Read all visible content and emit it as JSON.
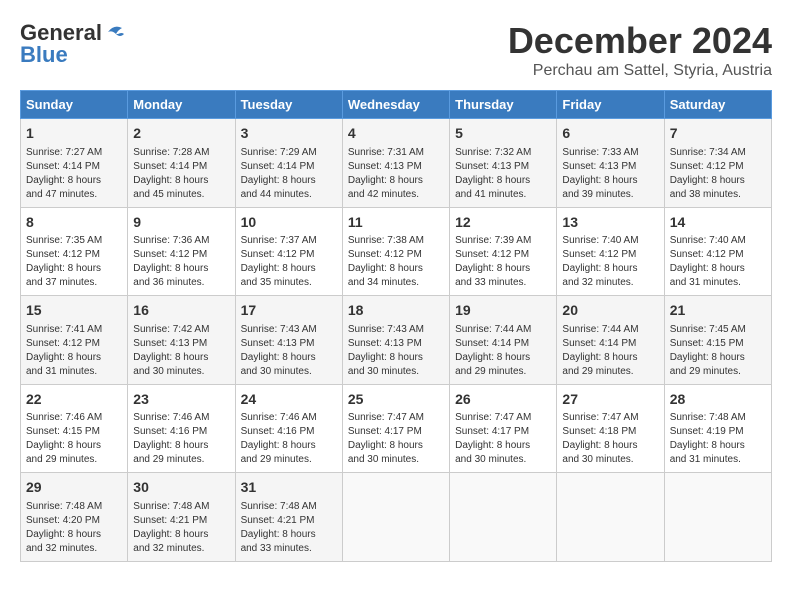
{
  "header": {
    "logo_line1": "General",
    "logo_line2": "Blue",
    "month": "December 2024",
    "location": "Perchau am Sattel, Styria, Austria"
  },
  "weekdays": [
    "Sunday",
    "Monday",
    "Tuesday",
    "Wednesday",
    "Thursday",
    "Friday",
    "Saturday"
  ],
  "weeks": [
    [
      {
        "day": "1",
        "info": "Sunrise: 7:27 AM\nSunset: 4:14 PM\nDaylight: 8 hours\nand 47 minutes."
      },
      {
        "day": "2",
        "info": "Sunrise: 7:28 AM\nSunset: 4:14 PM\nDaylight: 8 hours\nand 45 minutes."
      },
      {
        "day": "3",
        "info": "Sunrise: 7:29 AM\nSunset: 4:14 PM\nDaylight: 8 hours\nand 44 minutes."
      },
      {
        "day": "4",
        "info": "Sunrise: 7:31 AM\nSunset: 4:13 PM\nDaylight: 8 hours\nand 42 minutes."
      },
      {
        "day": "5",
        "info": "Sunrise: 7:32 AM\nSunset: 4:13 PM\nDaylight: 8 hours\nand 41 minutes."
      },
      {
        "day": "6",
        "info": "Sunrise: 7:33 AM\nSunset: 4:13 PM\nDaylight: 8 hours\nand 39 minutes."
      },
      {
        "day": "7",
        "info": "Sunrise: 7:34 AM\nSunset: 4:12 PM\nDaylight: 8 hours\nand 38 minutes."
      }
    ],
    [
      {
        "day": "8",
        "info": "Sunrise: 7:35 AM\nSunset: 4:12 PM\nDaylight: 8 hours\nand 37 minutes."
      },
      {
        "day": "9",
        "info": "Sunrise: 7:36 AM\nSunset: 4:12 PM\nDaylight: 8 hours\nand 36 minutes."
      },
      {
        "day": "10",
        "info": "Sunrise: 7:37 AM\nSunset: 4:12 PM\nDaylight: 8 hours\nand 35 minutes."
      },
      {
        "day": "11",
        "info": "Sunrise: 7:38 AM\nSunset: 4:12 PM\nDaylight: 8 hours\nand 34 minutes."
      },
      {
        "day": "12",
        "info": "Sunrise: 7:39 AM\nSunset: 4:12 PM\nDaylight: 8 hours\nand 33 minutes."
      },
      {
        "day": "13",
        "info": "Sunrise: 7:40 AM\nSunset: 4:12 PM\nDaylight: 8 hours\nand 32 minutes."
      },
      {
        "day": "14",
        "info": "Sunrise: 7:40 AM\nSunset: 4:12 PM\nDaylight: 8 hours\nand 31 minutes."
      }
    ],
    [
      {
        "day": "15",
        "info": "Sunrise: 7:41 AM\nSunset: 4:12 PM\nDaylight: 8 hours\nand 31 minutes."
      },
      {
        "day": "16",
        "info": "Sunrise: 7:42 AM\nSunset: 4:13 PM\nDaylight: 8 hours\nand 30 minutes."
      },
      {
        "day": "17",
        "info": "Sunrise: 7:43 AM\nSunset: 4:13 PM\nDaylight: 8 hours\nand 30 minutes."
      },
      {
        "day": "18",
        "info": "Sunrise: 7:43 AM\nSunset: 4:13 PM\nDaylight: 8 hours\nand 30 minutes."
      },
      {
        "day": "19",
        "info": "Sunrise: 7:44 AM\nSunset: 4:14 PM\nDaylight: 8 hours\nand 29 minutes."
      },
      {
        "day": "20",
        "info": "Sunrise: 7:44 AM\nSunset: 4:14 PM\nDaylight: 8 hours\nand 29 minutes."
      },
      {
        "day": "21",
        "info": "Sunrise: 7:45 AM\nSunset: 4:15 PM\nDaylight: 8 hours\nand 29 minutes."
      }
    ],
    [
      {
        "day": "22",
        "info": "Sunrise: 7:46 AM\nSunset: 4:15 PM\nDaylight: 8 hours\nand 29 minutes."
      },
      {
        "day": "23",
        "info": "Sunrise: 7:46 AM\nSunset: 4:16 PM\nDaylight: 8 hours\nand 29 minutes."
      },
      {
        "day": "24",
        "info": "Sunrise: 7:46 AM\nSunset: 4:16 PM\nDaylight: 8 hours\nand 29 minutes."
      },
      {
        "day": "25",
        "info": "Sunrise: 7:47 AM\nSunset: 4:17 PM\nDaylight: 8 hours\nand 30 minutes."
      },
      {
        "day": "26",
        "info": "Sunrise: 7:47 AM\nSunset: 4:17 PM\nDaylight: 8 hours\nand 30 minutes."
      },
      {
        "day": "27",
        "info": "Sunrise: 7:47 AM\nSunset: 4:18 PM\nDaylight: 8 hours\nand 30 minutes."
      },
      {
        "day": "28",
        "info": "Sunrise: 7:48 AM\nSunset: 4:19 PM\nDaylight: 8 hours\nand 31 minutes."
      }
    ],
    [
      {
        "day": "29",
        "info": "Sunrise: 7:48 AM\nSunset: 4:20 PM\nDaylight: 8 hours\nand 32 minutes."
      },
      {
        "day": "30",
        "info": "Sunrise: 7:48 AM\nSunset: 4:21 PM\nDaylight: 8 hours\nand 32 minutes."
      },
      {
        "day": "31",
        "info": "Sunrise: 7:48 AM\nSunset: 4:21 PM\nDaylight: 8 hours\nand 33 minutes."
      },
      {
        "day": "",
        "info": ""
      },
      {
        "day": "",
        "info": ""
      },
      {
        "day": "",
        "info": ""
      },
      {
        "day": "",
        "info": ""
      }
    ]
  ]
}
